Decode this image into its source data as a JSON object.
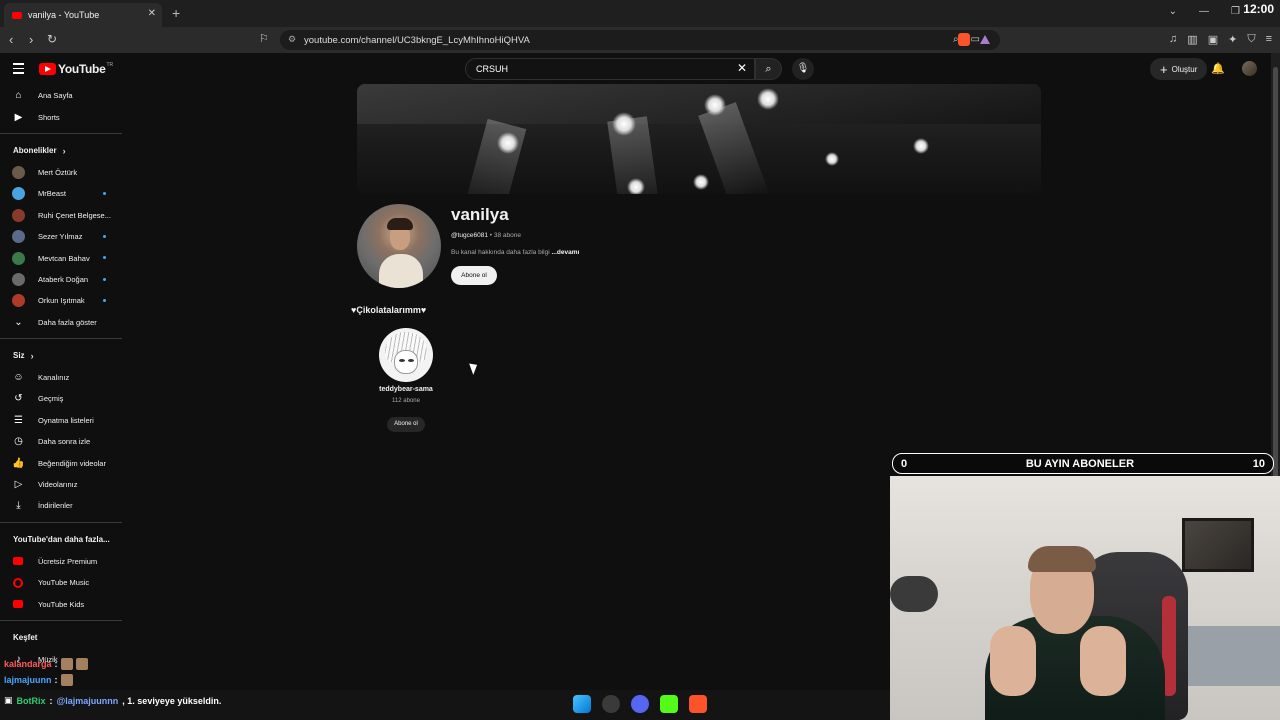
{
  "browser": {
    "tab_title": "vanilya - YouTube",
    "url": "youtube.com/channel/UC3bkngE_LcyMhIhnoHiQHVA",
    "clock": "12:00"
  },
  "youtube": {
    "logo_text": "YouTube",
    "logo_region": "TR",
    "search_value": "CRSUH",
    "create_label": "Oluştur"
  },
  "sidebar": {
    "main": [
      {
        "label": "Ana Sayfa",
        "icon": "home-icon"
      },
      {
        "label": "Shorts",
        "icon": "shorts-icon"
      }
    ],
    "subs_header": "Abonelikler",
    "subscriptions": [
      {
        "label": "Mert Öztürk",
        "live": false,
        "color": "#6a5a4a"
      },
      {
        "label": "MrBeast",
        "live": true,
        "color": "#4aa3df"
      },
      {
        "label": "Ruhi Çenet Belgese...",
        "live": false,
        "color": "#8a3a2a"
      },
      {
        "label": "Sezer Yılmaz",
        "live": true,
        "color": "#5a6a8a"
      },
      {
        "label": "Mevtcan Bahav",
        "live": true,
        "color": "#3a7a4a"
      },
      {
        "label": "Ataberk Doğan",
        "live": true,
        "color": "#6a6a6a"
      },
      {
        "label": "Orkun Işıtmak",
        "live": true,
        "color": "#b03a2a"
      }
    ],
    "show_more": "Daha fazla göster",
    "you_header": "Siz",
    "you_items": [
      {
        "label": "Kanalınız",
        "icon": "channel-icon"
      },
      {
        "label": "Geçmiş",
        "icon": "history-icon"
      },
      {
        "label": "Oynatma listeleri",
        "icon": "playlist-icon"
      },
      {
        "label": "Daha sonra izle",
        "icon": "clock-icon"
      },
      {
        "label": "Beğendiğim videolar",
        "icon": "like-icon"
      },
      {
        "label": "Videolarınız",
        "icon": "video-icon"
      },
      {
        "label": "İndirilenler",
        "icon": "download-icon"
      }
    ],
    "more_header": "YouTube'dan daha fazla...",
    "more_items": [
      {
        "label": "Ücretsiz Premium",
        "icon": "youtube-premium-icon"
      },
      {
        "label": "YouTube Music",
        "icon": "youtube-music-icon"
      },
      {
        "label": "YouTube Kids",
        "icon": "youtube-kids-icon"
      }
    ],
    "explore_header": "Keşfet",
    "explore_items": [
      {
        "label": "Müzik",
        "icon": "music-icon"
      }
    ]
  },
  "channel": {
    "name": "vanilya",
    "handle": "@tugce6081",
    "subscribers": "38 abone",
    "description": "Bu kanal hakkında daha fazla bilgi",
    "more_link": "...devamı",
    "subscribe_label": "Abone ol"
  },
  "featured": {
    "section_title": "♥Çikolatalarımm♥",
    "channel_name": "teddybear-sama",
    "subscribers": "112 abone",
    "subscribe_label": "Abone ol"
  },
  "overlay": {
    "goal_left": "0",
    "goal_title": "BU AYIN ABONELER",
    "goal_right": "10"
  },
  "chat": {
    "line1_user": "kalandarga",
    "line2_user": "lajmajuunn",
    "bot_user": "BotRix",
    "bot_mention": "@lajmajuunnn",
    "bot_message": ", 1. seviyeye yükseldin."
  }
}
